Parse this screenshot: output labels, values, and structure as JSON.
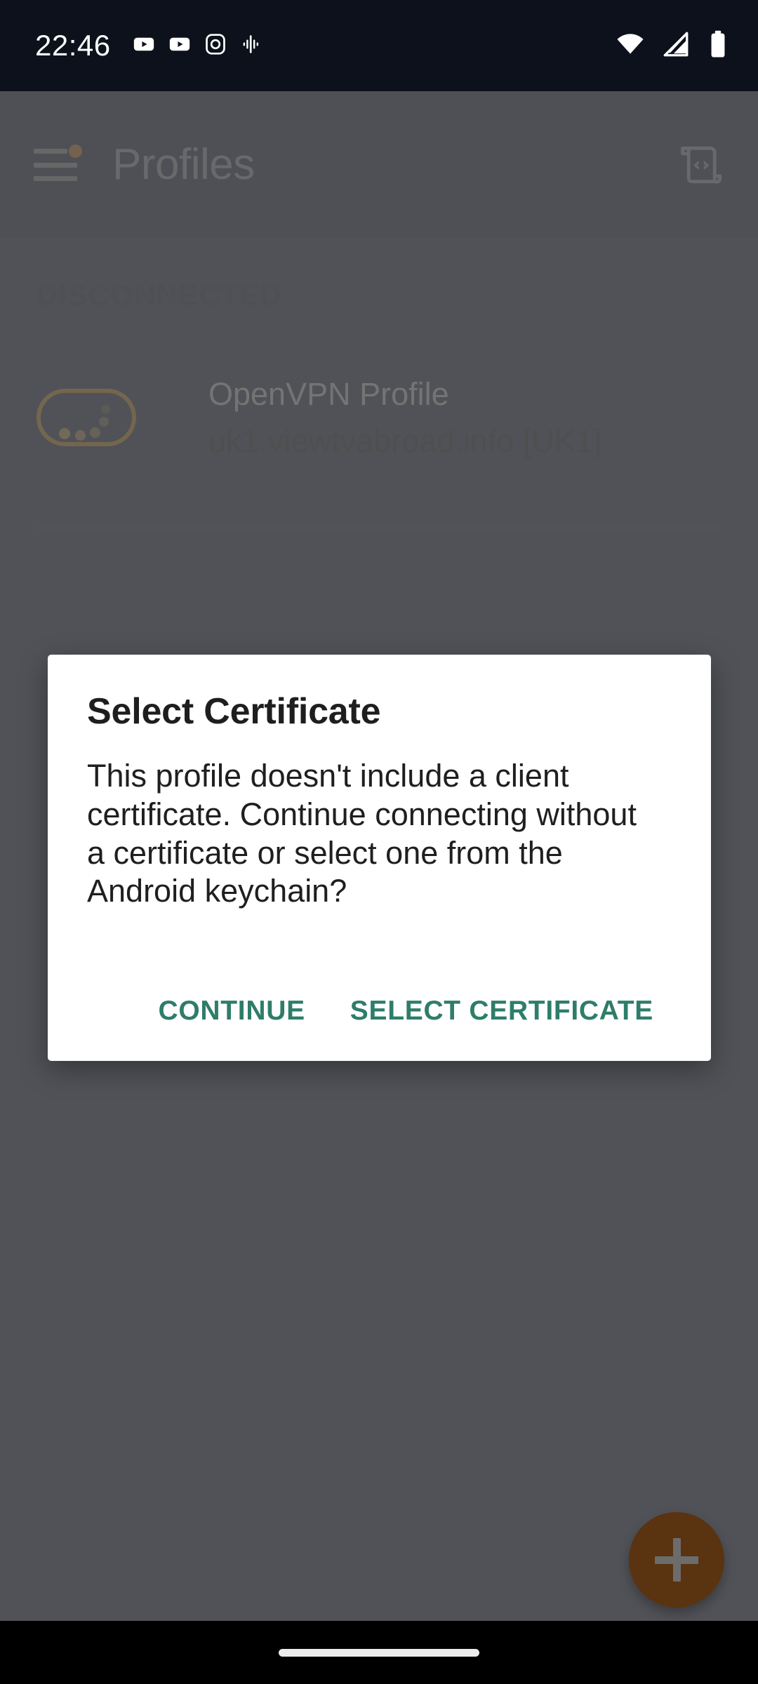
{
  "status_bar": {
    "time": "22:46",
    "left_icons": [
      "youtube-icon",
      "youtube-icon",
      "instagram-icon",
      "google-recorder-icon"
    ],
    "right_icons": [
      "wifi-icon",
      "cellular-no-sim-icon",
      "battery-icon"
    ]
  },
  "app_bar": {
    "menu_icon": "hamburger-menu-icon",
    "menu_badge": "update-available-dot",
    "title": "Profiles",
    "action_icon": "import-config-script-icon"
  },
  "content": {
    "section_header": "DISCONNECTED",
    "profile": {
      "toggle_icon": "connection-toggle-pill",
      "label": "OpenVPN Profile",
      "server": "uk1.viewtvabroad.info [UK1]"
    }
  },
  "fab": {
    "icon": "plus-icon",
    "label": "Add profile"
  },
  "dialog": {
    "title": "Select Certificate",
    "body": "This profile doesn't include a client certificate. Continue connecting without a certificate or select one from the Android keychain?",
    "buttons": [
      {
        "label": "CONTINUE"
      },
      {
        "label": "SELECT CERTIFICATE"
      }
    ]
  },
  "nav_bar": {
    "gesture_pill": "home-gesture-pill"
  },
  "colors": {
    "status_bar_bg": "#0c111b",
    "app_bar_bg": "#141c2e",
    "content_bg": "#1b2233",
    "accent_amber": "#9a6a13",
    "badge_orange": "#9a5c18",
    "fab_bg": "#5a3310",
    "dialog_bg": "#ffffff",
    "dialog_action_text": "#2e7d6a",
    "scrim": "rgba(101,101,101,0.72)",
    "nav_bar_bg": "#000000"
  }
}
